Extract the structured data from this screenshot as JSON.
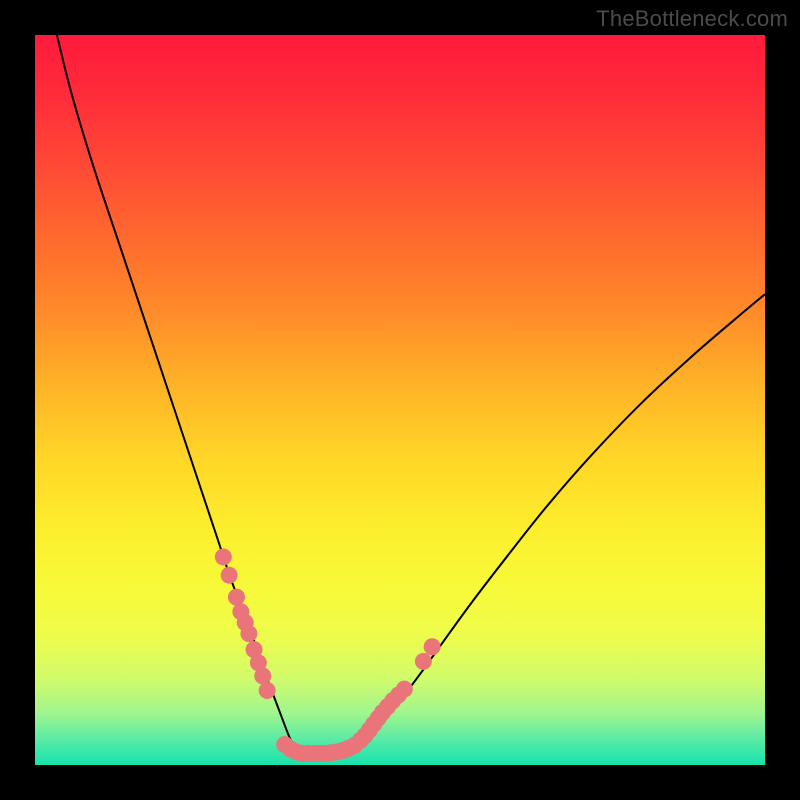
{
  "watermark": "TheBottleneck.com",
  "colors": {
    "frame": "#000000",
    "curve_stroke": "#000000",
    "marker_fill": "#e9757b",
    "marker_stroke": "#d9636a"
  },
  "chart_data": {
    "type": "line",
    "title": "",
    "xlabel": "",
    "ylabel": "",
    "xlim": [
      0,
      100
    ],
    "ylim": [
      0,
      100
    ],
    "grid": false,
    "legend": false,
    "series": [
      {
        "name": "curve",
        "x": [
          3,
          5,
          8,
          12,
          16,
          20,
          23,
          25,
          27,
          29,
          31,
          32.5,
          34,
          35,
          36,
          37,
          38,
          40,
          42,
          44,
          46,
          48,
          50,
          53,
          56,
          60,
          65,
          70,
          76,
          83,
          90,
          97,
          100
        ],
        "y": [
          100,
          92,
          82,
          70,
          58,
          46,
          37,
          31,
          25,
          20,
          14,
          10,
          6,
          3.5,
          2,
          1.2,
          1,
          1,
          1.4,
          2.4,
          4,
          6.2,
          8.8,
          12.8,
          17,
          22.5,
          29,
          35.3,
          42.2,
          49.5,
          56,
          62,
          64.5
        ]
      },
      {
        "name": "markers-left",
        "x": [
          25.8,
          26.6,
          27.6,
          28.2,
          28.8,
          29.3,
          30.0,
          30.6,
          31.2,
          31.8
        ],
        "y": [
          28.5,
          26.0,
          23.0,
          21.0,
          19.5,
          18.0,
          15.8,
          14.0,
          12.2,
          10.2
        ]
      },
      {
        "name": "markers-bottom",
        "x": [
          34.2,
          35.0,
          35.8,
          36.6,
          37.4,
          38.2,
          39.0,
          39.8,
          40.6,
          41.4,
          42.2,
          43.0,
          43.8
        ],
        "y": [
          2.8,
          2.2,
          1.8,
          1.6,
          1.6,
          1.6,
          1.6,
          1.6,
          1.7,
          1.8,
          2.0,
          2.3,
          2.7
        ]
      },
      {
        "name": "markers-right",
        "x": [
          44.6,
          45.2,
          45.8,
          46.4,
          47.0,
          47.6,
          48.3,
          49.0,
          49.8,
          50.6,
          53.2,
          54.4
        ],
        "y": [
          3.4,
          4.0,
          4.8,
          5.6,
          6.4,
          7.2,
          8.0,
          8.8,
          9.6,
          10.4,
          14.2,
          16.2
        ]
      }
    ]
  }
}
